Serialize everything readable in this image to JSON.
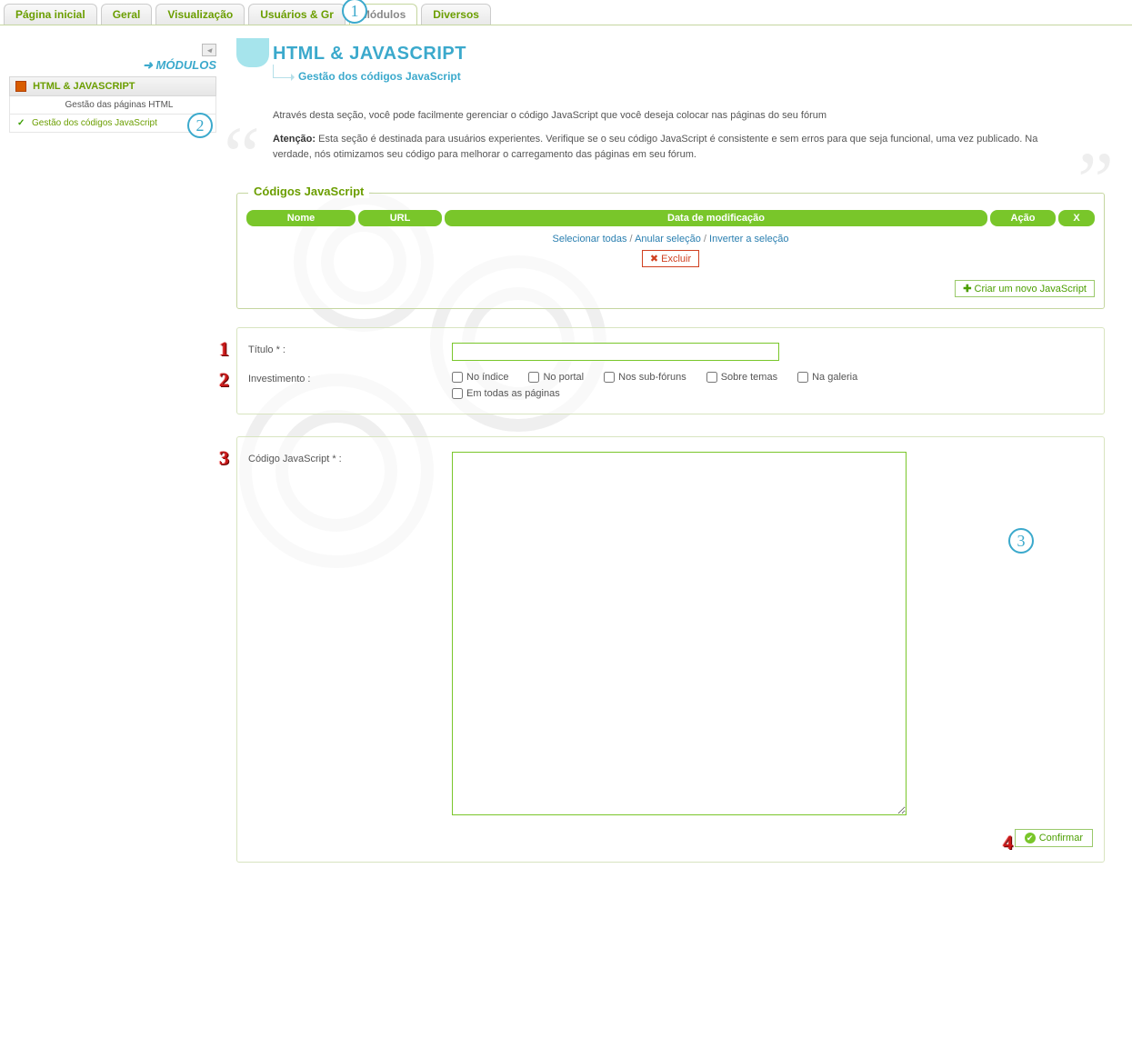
{
  "tabs": {
    "home": "Página inicial",
    "geral": "Geral",
    "visual": "Visualização",
    "users": "Usuários & Gr",
    "modulos": "Módulos",
    "diversos": "Diversos"
  },
  "sidebar": {
    "header": "MÓDULOS",
    "category": "HTML & JAVASCRIPT",
    "item_html": "Gestão das páginas HTML",
    "item_js": "Gestão dos códigos JavaScript"
  },
  "header": {
    "title": "HTML & JAVASCRIPT",
    "subtitle": "Gestão dos códigos JavaScript"
  },
  "intro": {
    "p1": "Através desta seção, você pode facilmente gerenciar o código JavaScript que você deseja colocar nas páginas do seu fórum",
    "att_label": "Atenção:",
    "p2": "Esta seção é destinada para usuários experientes. Verifique se o seu código JavaScript é consistente e sem erros para que seja funcional, uma vez publicado. Na verdade, nós otimizamos seu código para melhorar o carregamento das páginas em seu fórum."
  },
  "panel": {
    "title": "Códigos JavaScript",
    "cols": {
      "nome": "Nome",
      "url": "URL",
      "data": "Data de modificação",
      "acao": "Ação",
      "x": "X"
    },
    "sel_all": "Selecionar todas",
    "desel": "Anular seleção",
    "invert": "Inverter a seleção",
    "delete": "Excluir",
    "create": "Criar um novo JavaScript"
  },
  "form": {
    "titulo_label": "Título * :",
    "invest_label": "Investimento :",
    "chk_indice": "No índice",
    "chk_portal": "No portal",
    "chk_subforum": "Nos sub-fóruns",
    "chk_temas": "Sobre temas",
    "chk_galeria": "Na galeria",
    "chk_todas": "Em todas as páginas",
    "code_label": "Código JavaScript * :",
    "confirmar": "Confirmar"
  },
  "steps": {
    "s1": "1",
    "s2": "2",
    "s3": "3",
    "r1": "1",
    "r2": "2",
    "r3": "3",
    "r4": "4"
  }
}
